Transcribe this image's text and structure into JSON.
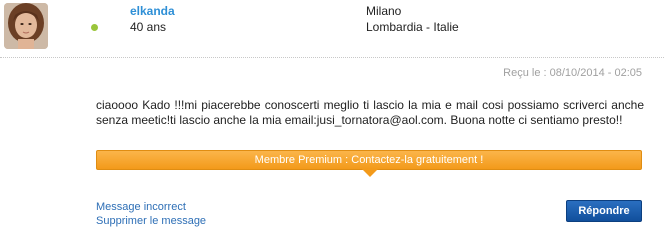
{
  "profile": {
    "username": "elkanda",
    "age": "40 ans",
    "city": "Milano",
    "region": "Lombardia - Italie",
    "online_status": "online",
    "online_color": "#9ac53b",
    "username_color": "#2e8fd6"
  },
  "meta": {
    "received": "Reçu le : 08/10/2014 - 02:05"
  },
  "message": {
    "body": "ciaoooo Kado !!!mi piacerebbe conoscerti meglio ti lascio la mia e mail cosi possiamo scriverci anche senza meetic!ti lascio anche la mia email:jusi_tornatora@aol.com. Buona notte ci sentiamo presto!!"
  },
  "premium": {
    "label": "Membre Premium : Contactez-la gratuitement !",
    "color": "#f39a1a"
  },
  "actions": {
    "report_link": "Message incorrect",
    "delete_link": "Supprimer le message",
    "reply_button": "Répondre",
    "reply_color": "#1a5fb0"
  }
}
